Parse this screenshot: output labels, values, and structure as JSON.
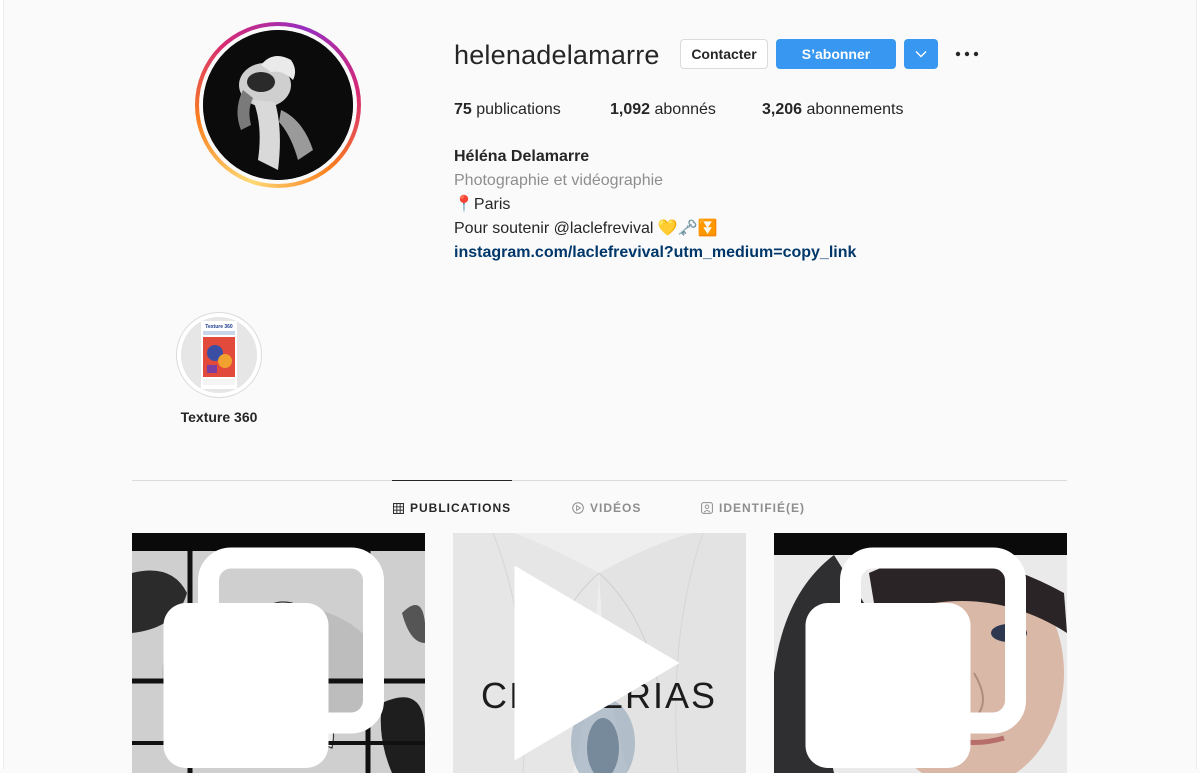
{
  "profile": {
    "username": "helenadelamarre",
    "contact_label": "Contacter",
    "follow_label": "S’abonner"
  },
  "stats": {
    "posts_count": "75",
    "posts_label": "publications",
    "followers_count": "1,092",
    "followers_label": "abonnés",
    "following_count": "3,206",
    "following_label": "abonnements"
  },
  "bio": {
    "full_name": "Héléna Delamarre",
    "category": "Photographie et vidéographie",
    "location": "📍Paris",
    "text": "Pour soutenir @laclefrevival 💛🗝️⏬",
    "link": "instagram.com/laclefrevival?utm_medium=copy_link"
  },
  "highlights": [
    {
      "label": "Texture 360",
      "cover_text": "Texture 360"
    }
  ],
  "tabs": [
    {
      "label": "PUBLICATIONS",
      "icon": "grid-icon",
      "active": true
    },
    {
      "label": "VIDÉOS",
      "icon": "play-circle-icon",
      "active": false
    },
    {
      "label": "IDENTIFIÉ(E)",
      "icon": "tagged-icon",
      "active": false
    }
  ],
  "posts": [
    {
      "kind": "carousel",
      "icon": "carousel-icon"
    },
    {
      "kind": "video",
      "icon": "video-icon",
      "overlay_text": "CITHAERIAS"
    },
    {
      "kind": "carousel",
      "icon": "carousel-icon"
    }
  ],
  "colors": {
    "accent": "#3897f0",
    "link": "#00376b",
    "muted": "#8e8e8e",
    "text": "#262626",
    "border": "#dbdbdb",
    "background": "#fafafa"
  }
}
